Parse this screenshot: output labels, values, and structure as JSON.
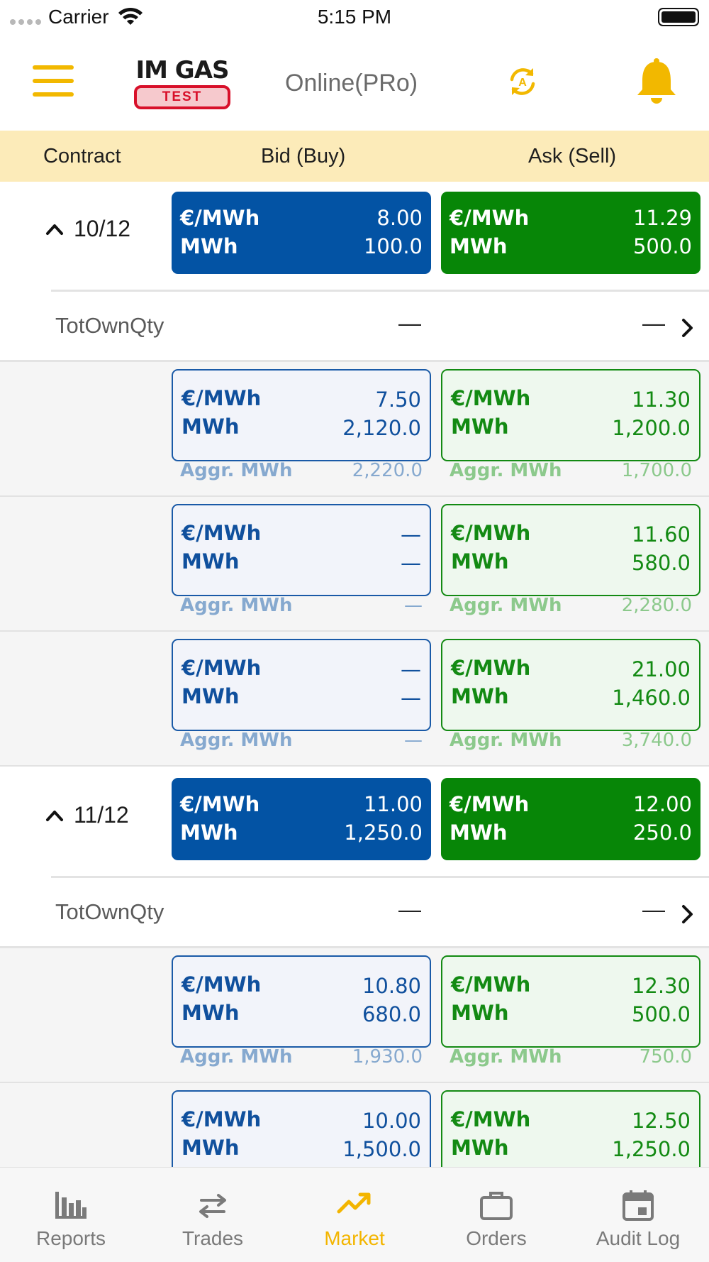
{
  "status_bar": {
    "carrier": "Carrier",
    "time": "5:15 PM"
  },
  "header": {
    "logo_title": "IM GAS",
    "logo_badge": "TEST",
    "connection_status": "Online(PRo)",
    "icons": [
      "menu-icon",
      "sync-icon",
      "bell-icon"
    ],
    "accent_color": "#f2b800"
  },
  "columns": {
    "contract": "Contract",
    "bid": "Bid (Buy)",
    "ask": "Ask (Sell)"
  },
  "colors": {
    "bid_solid": "#0353a4",
    "ask_solid": "#078607",
    "header_bg": "#fcebb9"
  },
  "contracts": [
    {
      "label": "10/12",
      "best_bid": {
        "price_label": "€/MWh",
        "price": "8.00",
        "qty_label": "MWh",
        "qty": "100.0"
      },
      "best_ask": {
        "price_label": "€/MWh",
        "price": "11.29",
        "qty_label": "MWh",
        "qty": "500.0"
      },
      "own": {
        "label": "TotOwnQty",
        "bid": "—",
        "ask": "—"
      },
      "levels": [
        {
          "bid": {
            "price_label": "€/MWh",
            "price": "7.50",
            "qty_label": "MWh",
            "qty": "2,120.0",
            "aggr_label": "Aggr. MWh",
            "aggr": "2,220.0"
          },
          "ask": {
            "price_label": "€/MWh",
            "price": "11.30",
            "qty_label": "MWh",
            "qty": "1,200.0",
            "aggr_label": "Aggr. MWh",
            "aggr": "1,700.0"
          }
        },
        {
          "bid": {
            "price_label": "€/MWh",
            "price": "—",
            "qty_label": "MWh",
            "qty": "—",
            "aggr_label": "Aggr. MWh",
            "aggr": "—"
          },
          "ask": {
            "price_label": "€/MWh",
            "price": "11.60",
            "qty_label": "MWh",
            "qty": "580.0",
            "aggr_label": "Aggr. MWh",
            "aggr": "2,280.0"
          }
        },
        {
          "bid": {
            "price_label": "€/MWh",
            "price": "—",
            "qty_label": "MWh",
            "qty": "—",
            "aggr_label": "Aggr. MWh",
            "aggr": "—"
          },
          "ask": {
            "price_label": "€/MWh",
            "price": "21.00",
            "qty_label": "MWh",
            "qty": "1,460.0",
            "aggr_label": "Aggr. MWh",
            "aggr": "3,740.0"
          }
        }
      ]
    },
    {
      "label": "11/12",
      "best_bid": {
        "price_label": "€/MWh",
        "price": "11.00",
        "qty_label": "MWh",
        "qty": "1,250.0"
      },
      "best_ask": {
        "price_label": "€/MWh",
        "price": "12.00",
        "qty_label": "MWh",
        "qty": "250.0"
      },
      "own": {
        "label": "TotOwnQty",
        "bid": "—",
        "ask": "—"
      },
      "levels": [
        {
          "bid": {
            "price_label": "€/MWh",
            "price": "10.80",
            "qty_label": "MWh",
            "qty": "680.0",
            "aggr_label": "Aggr. MWh",
            "aggr": "1,930.0"
          },
          "ask": {
            "price_label": "€/MWh",
            "price": "12.30",
            "qty_label": "MWh",
            "qty": "500.0",
            "aggr_label": "Aggr. MWh",
            "aggr": "750.0"
          }
        },
        {
          "bid": {
            "price_label": "€/MWh",
            "price": "10.00",
            "qty_label": "MWh",
            "qty": "1,500.0"
          },
          "ask": {
            "price_label": "€/MWh",
            "price": "12.50",
            "qty_label": "MWh",
            "qty": "1,250.0"
          }
        }
      ]
    }
  ],
  "tabs": [
    {
      "label": "Reports",
      "icon": "bar-chart-icon"
    },
    {
      "label": "Trades",
      "icon": "swap-arrows-icon"
    },
    {
      "label": "Market",
      "icon": "trend-up-icon",
      "active": true
    },
    {
      "label": "Orders",
      "icon": "briefcase-icon"
    },
    {
      "label": "Audit Log",
      "icon": "calendar-icon"
    }
  ]
}
